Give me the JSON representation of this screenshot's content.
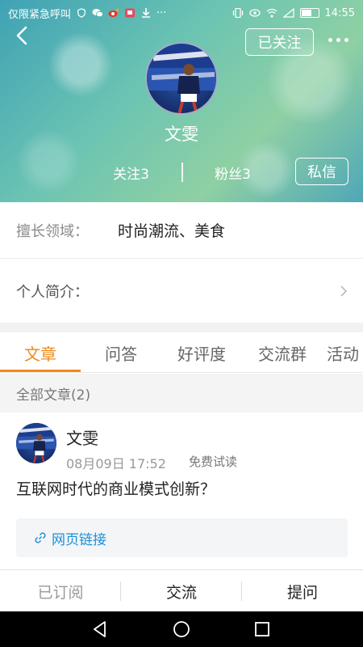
{
  "status_bar": {
    "carrier_text": "仅限紧急呼叫",
    "time": "14:55",
    "extra_icons": [
      "shield-icon",
      "wechat-icon",
      "weibo-icon",
      "app-icon",
      "download-icon",
      "more-icon"
    ]
  },
  "header": {
    "follow_button_label": "已关注",
    "profile_name": "文雯",
    "following_label": "关注3",
    "fans_label": "粉丝3",
    "message_button_label": "私信"
  },
  "info": {
    "field_label": "擅长领域：",
    "field_value": "时尚潮流、美食",
    "intro_label": "个人简介："
  },
  "tabs": [
    {
      "label": "文章",
      "active": true
    },
    {
      "label": "问答",
      "active": false
    },
    {
      "label": "好评度",
      "active": false
    },
    {
      "label": "交流群",
      "active": false
    },
    {
      "label": "活动",
      "active": false
    }
  ],
  "section": {
    "title": "全部文章(2)"
  },
  "article": {
    "author": "文雯",
    "time": "08月09日 17:52",
    "badge": "免费试读",
    "title": "互联网时代的商业模式创新？",
    "link_label": "网页链接"
  },
  "bottom_bar": {
    "subscribed_label": "已订阅",
    "chat_label": "交流",
    "ask_label": "提问"
  },
  "colors": {
    "accent": "#f08a1c",
    "link": "#1b8fd8",
    "hero_start": "#3fa2b5",
    "hero_end": "#8fd0a4"
  }
}
